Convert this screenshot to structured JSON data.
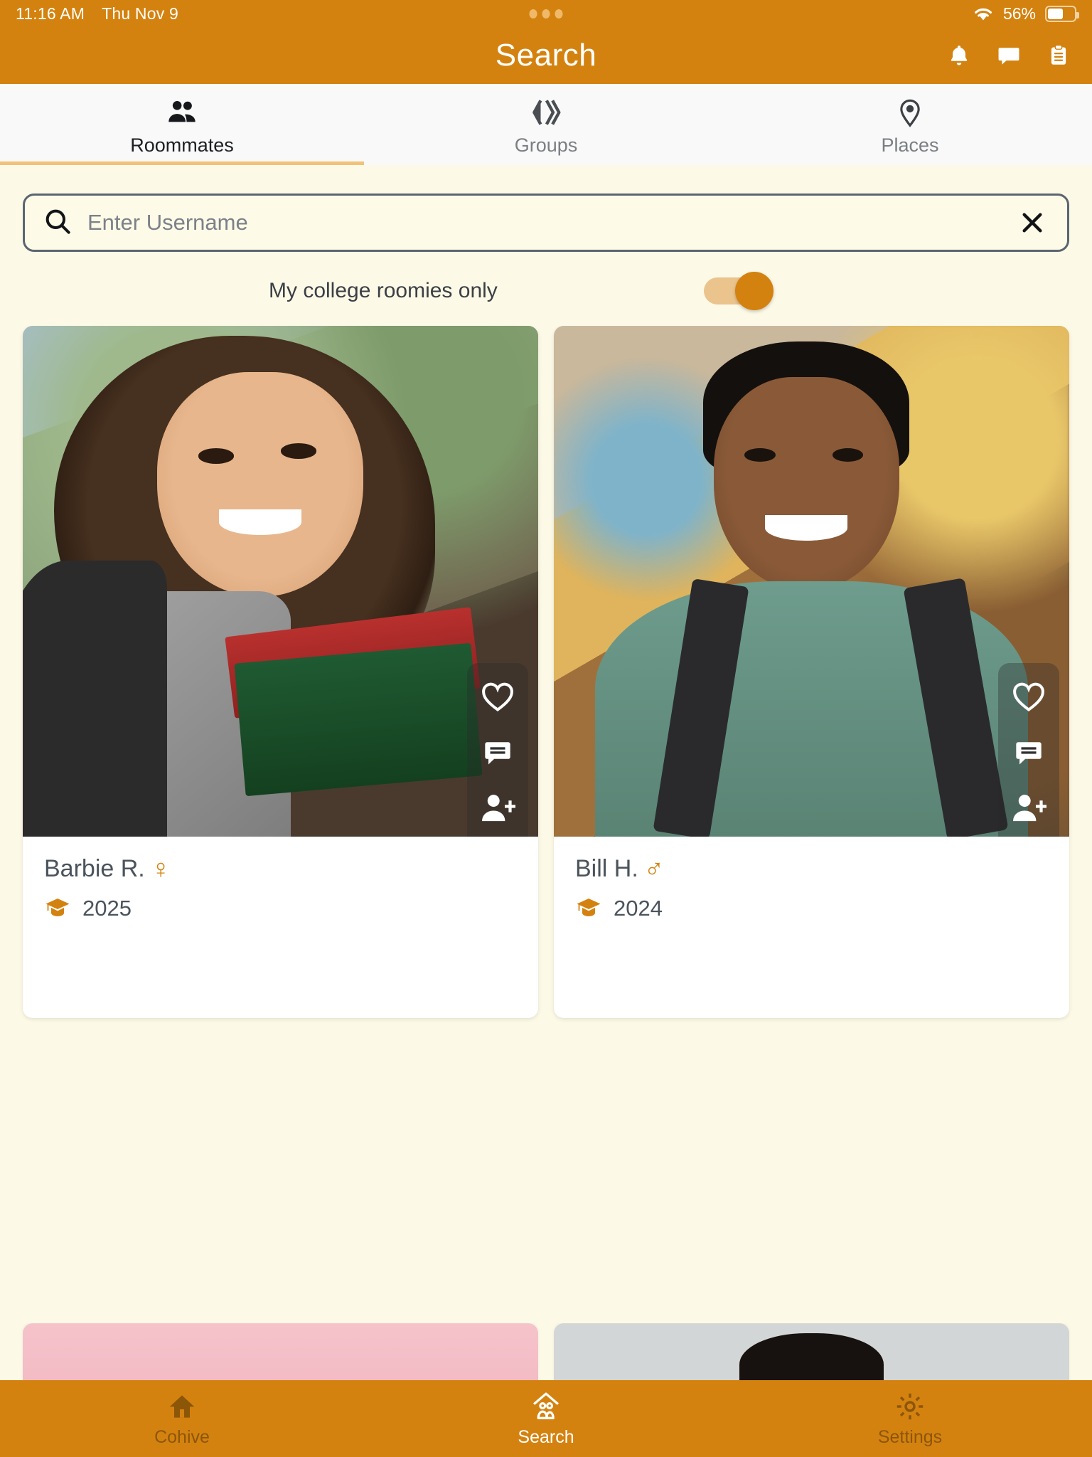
{
  "status_bar": {
    "time": "11:16 AM",
    "date": "Thu Nov 9",
    "battery_percent": "56%",
    "wifi_icon": "wifi-icon",
    "battery_icon": "battery-icon",
    "dots_icon": "recording-dots-icon"
  },
  "header": {
    "title": "Search",
    "icons": [
      {
        "name": "notifications-bell-icon",
        "glyph": "bell"
      },
      {
        "name": "messages-chat-icon",
        "glyph": "chat"
      },
      {
        "name": "clipboard-list-icon",
        "glyph": "clipboard"
      }
    ]
  },
  "tabs": [
    {
      "label": "Roommates",
      "icon": "people-icon",
      "active": true
    },
    {
      "label": "Groups",
      "icon": "groups-chevrons-icon",
      "active": false
    },
    {
      "label": "Places",
      "icon": "map-pin-icon",
      "active": false
    }
  ],
  "search": {
    "placeholder": "Enter Username",
    "value": "",
    "search_icon": "search-icon",
    "clear_icon": "close-x-icon"
  },
  "filter": {
    "label": "My college roomies only",
    "enabled": true,
    "track_color": "#EBC48D",
    "thumb_color": "#D4820F"
  },
  "colors": {
    "brand_orange": "#D4820F",
    "page_background": "#FDF9E7",
    "accent_underline": "#F1C277",
    "text_dark": "#4B535C"
  },
  "results": [
    {
      "name": "Barbie R.",
      "gender_symbol": "♀",
      "gender": "female",
      "grad_year": "2025",
      "grad_icon": "graduation-cap-icon",
      "actions": [
        {
          "name": "favorite-heart-icon"
        },
        {
          "name": "message-chat-icon"
        },
        {
          "name": "add-friend-icon"
        }
      ]
    },
    {
      "name": "Bill H.",
      "gender_symbol": "♂",
      "gender": "male",
      "grad_year": "2024",
      "grad_icon": "graduation-cap-icon",
      "actions": [
        {
          "name": "favorite-heart-icon"
        },
        {
          "name": "message-chat-icon"
        },
        {
          "name": "add-friend-icon"
        }
      ]
    }
  ],
  "bottom_nav": [
    {
      "label": "Cohive",
      "icon": "home-icon",
      "active": false
    },
    {
      "label": "Search",
      "icon": "search-people-house-icon",
      "active": true
    },
    {
      "label": "Settings",
      "icon": "gear-icon",
      "active": false
    }
  ]
}
